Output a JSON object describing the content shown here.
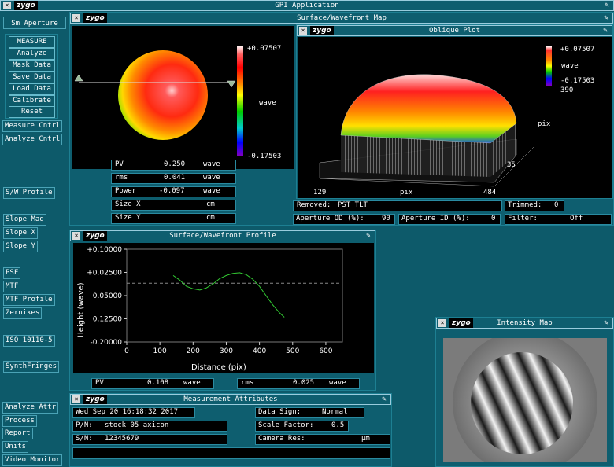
{
  "app": {
    "title": "GPI Application",
    "logo": "zygo"
  },
  "sidebar": {
    "sm_aperture": "Sm Aperture",
    "controls": [
      "MEASURE",
      "Analyze",
      "Mask Data",
      "Save Data",
      "Load Data",
      "Calibrate",
      "Reset"
    ],
    "items": [
      "Measure Cntrl",
      "Analyze Cntrl",
      "S/W Profile",
      "Slope Mag",
      "Slope X",
      "Slope Y",
      "PSF",
      "MTF",
      "MTF Profile",
      "Zernikes",
      "ISO 10110-5",
      "SynthFringes",
      "Analyze Attr",
      "Process",
      "Report",
      "Units",
      "Video Monitor"
    ]
  },
  "surface_map": {
    "title": "Surface/Wavefront Map",
    "scale_max": "+0.07507",
    "scale_unit": "wave",
    "scale_min": "-0.17503",
    "results": [
      {
        "label": "PV",
        "value": "0.250",
        "unit": "wave"
      },
      {
        "label": "rms",
        "value": "0.041",
        "unit": "wave"
      },
      {
        "label": "Power",
        "value": "-0.097",
        "unit": "wave"
      },
      {
        "label": "Size X",
        "value": "",
        "unit": "cm"
      },
      {
        "label": "Size Y",
        "value": "",
        "unit": "cm"
      }
    ]
  },
  "oblique_plot": {
    "title": "Oblique Plot",
    "scale_max": "+0.07507",
    "scale_unit": "wave",
    "scale_min": "-0.17503",
    "scale_extra": "390",
    "axis_y_label": "pix",
    "axis_y_val": "35",
    "axis_x_min": "129",
    "axis_x_label": "pix",
    "axis_x_max": "484"
  },
  "status_fields": {
    "removed_label": "Removed:",
    "removed_value": "PST TLT",
    "trimmed_label": "Trimmed:",
    "trimmed_value": "0",
    "aperture_od_label": "Aperture OD (%):",
    "aperture_od_value": "90",
    "aperture_id_label": "Aperture ID (%):",
    "aperture_id_value": "0",
    "filter_label": "Filter:",
    "filter_value": "Off"
  },
  "profile": {
    "title": "Surface/Wavefront Profile",
    "y_label": "Height (wave)",
    "x_label": "Distance (pix)",
    "y_ticks": [
      "+0.10000",
      "+0.02500",
      "0.05000",
      "0.12500",
      "-0.20000"
    ],
    "x_ticks": [
      "0",
      "100",
      "200",
      "300",
      "400",
      "500",
      "600"
    ],
    "pv_label": "PV",
    "pv_value": "0.108",
    "pv_unit": "wave",
    "rms_label": "rms",
    "rms_value": "0.025",
    "rms_unit": "wave"
  },
  "chart_data": {
    "type": "line",
    "x": [
      140,
      160,
      180,
      200,
      220,
      240,
      260,
      280,
      300,
      320,
      340,
      360,
      380,
      400,
      420,
      440,
      460,
      475
    ],
    "y": [
      0.015,
      0.0,
      -0.02,
      -0.028,
      -0.032,
      -0.025,
      -0.012,
      0.005,
      0.015,
      0.022,
      0.024,
      0.018,
      0.003,
      -0.02,
      -0.05,
      -0.08,
      -0.105,
      -0.12
    ],
    "xlabel": "Distance (pix)",
    "ylabel": "Height (wave)",
    "xlim": [
      0,
      650
    ],
    "ylim": [
      -0.2,
      0.1
    ],
    "reference_line": -0.01
  },
  "intensity": {
    "title": "Intensity Map"
  },
  "attributes": {
    "title": "Measurement Attributes",
    "date": "Wed Sep 20 16:18:32 2017",
    "pn_label": "P/N:",
    "pn_value": "stock 05 axicon",
    "sn_label": "S/N:",
    "sn_value": "12345679",
    "data_sign_label": "Data Sign:",
    "data_sign_value": "Normal",
    "scale_factor_label": "Scale Factor:",
    "scale_factor_value": "0.5",
    "camera_res_label": "Camera Res:",
    "camera_res_unit": "µm"
  },
  "colors": {
    "background": "#0d5a6a",
    "plot_bg": "#000000",
    "profile_line": "#33cc33"
  }
}
